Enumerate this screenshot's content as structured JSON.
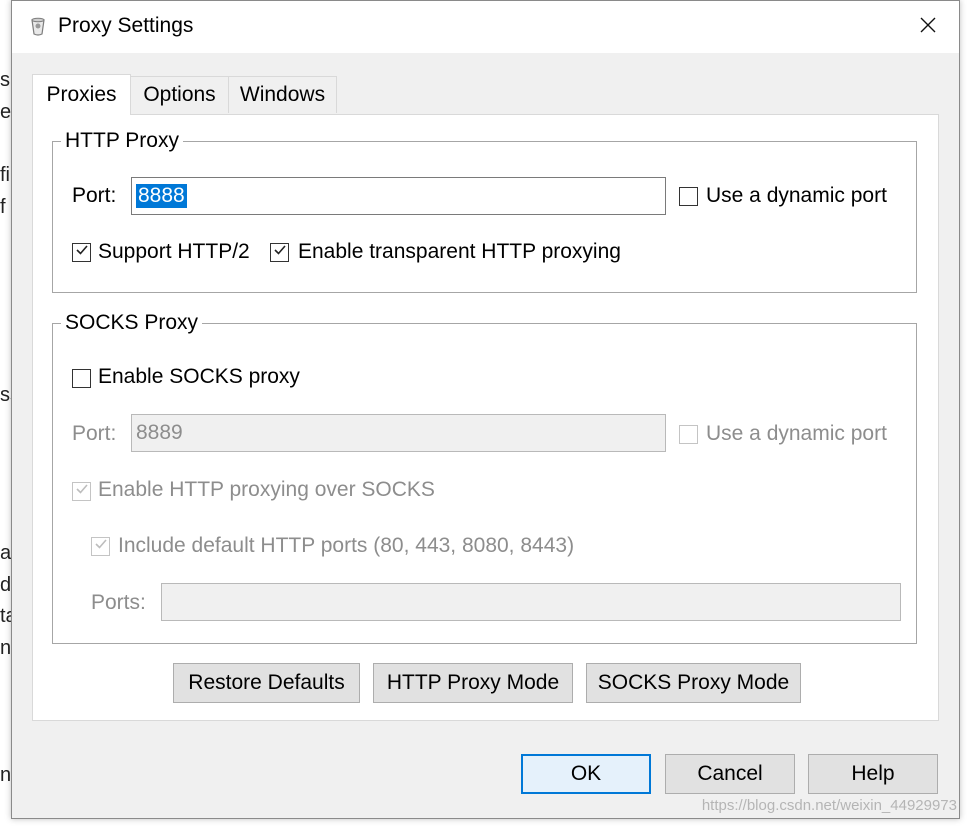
{
  "window": {
    "title": "Proxy Settings",
    "close_icon": "close-icon",
    "app_icon": "app-icon"
  },
  "tabs": [
    {
      "label": "Proxies",
      "active": true
    },
    {
      "label": "Options",
      "active": false
    },
    {
      "label": "Windows",
      "active": false
    }
  ],
  "http_proxy": {
    "group_title": "HTTP Proxy",
    "port_label": "Port:",
    "port_value": "8888",
    "dynamic_port_label": "Use a dynamic port",
    "dynamic_port_checked": false,
    "support_http2_label": "Support HTTP/2",
    "support_http2_checked": true,
    "transparent_label": "Enable transparent HTTP proxying",
    "transparent_checked": true
  },
  "socks_proxy": {
    "group_title": "SOCKS Proxy",
    "enable_label": "Enable SOCKS proxy",
    "enable_checked": false,
    "port_label": "Port:",
    "port_value": "8889",
    "dynamic_port_label": "Use a dynamic port",
    "dynamic_port_checked": false,
    "http_over_socks_label": "Enable HTTP proxying over SOCKS",
    "http_over_socks_checked": true,
    "include_default_label": "Include default HTTP ports (80, 443, 8080, 8443)",
    "include_default_checked": true,
    "ports_label": "Ports:",
    "ports_value": ""
  },
  "panel_buttons": {
    "restore": "Restore Defaults",
    "http_mode": "HTTP Proxy Mode",
    "socks_mode": "SOCKS Proxy Mode"
  },
  "dialog_buttons": {
    "ok": "OK",
    "cancel": "Cancel",
    "help": "Help"
  },
  "background_fragments": [
    "su",
    "e",
    "fi",
    "f",
    "ss",
    "ar",
    "d",
    "ta",
    "n",
    "na"
  ],
  "watermark": "https://blog.csdn.net/weixin_44929973"
}
